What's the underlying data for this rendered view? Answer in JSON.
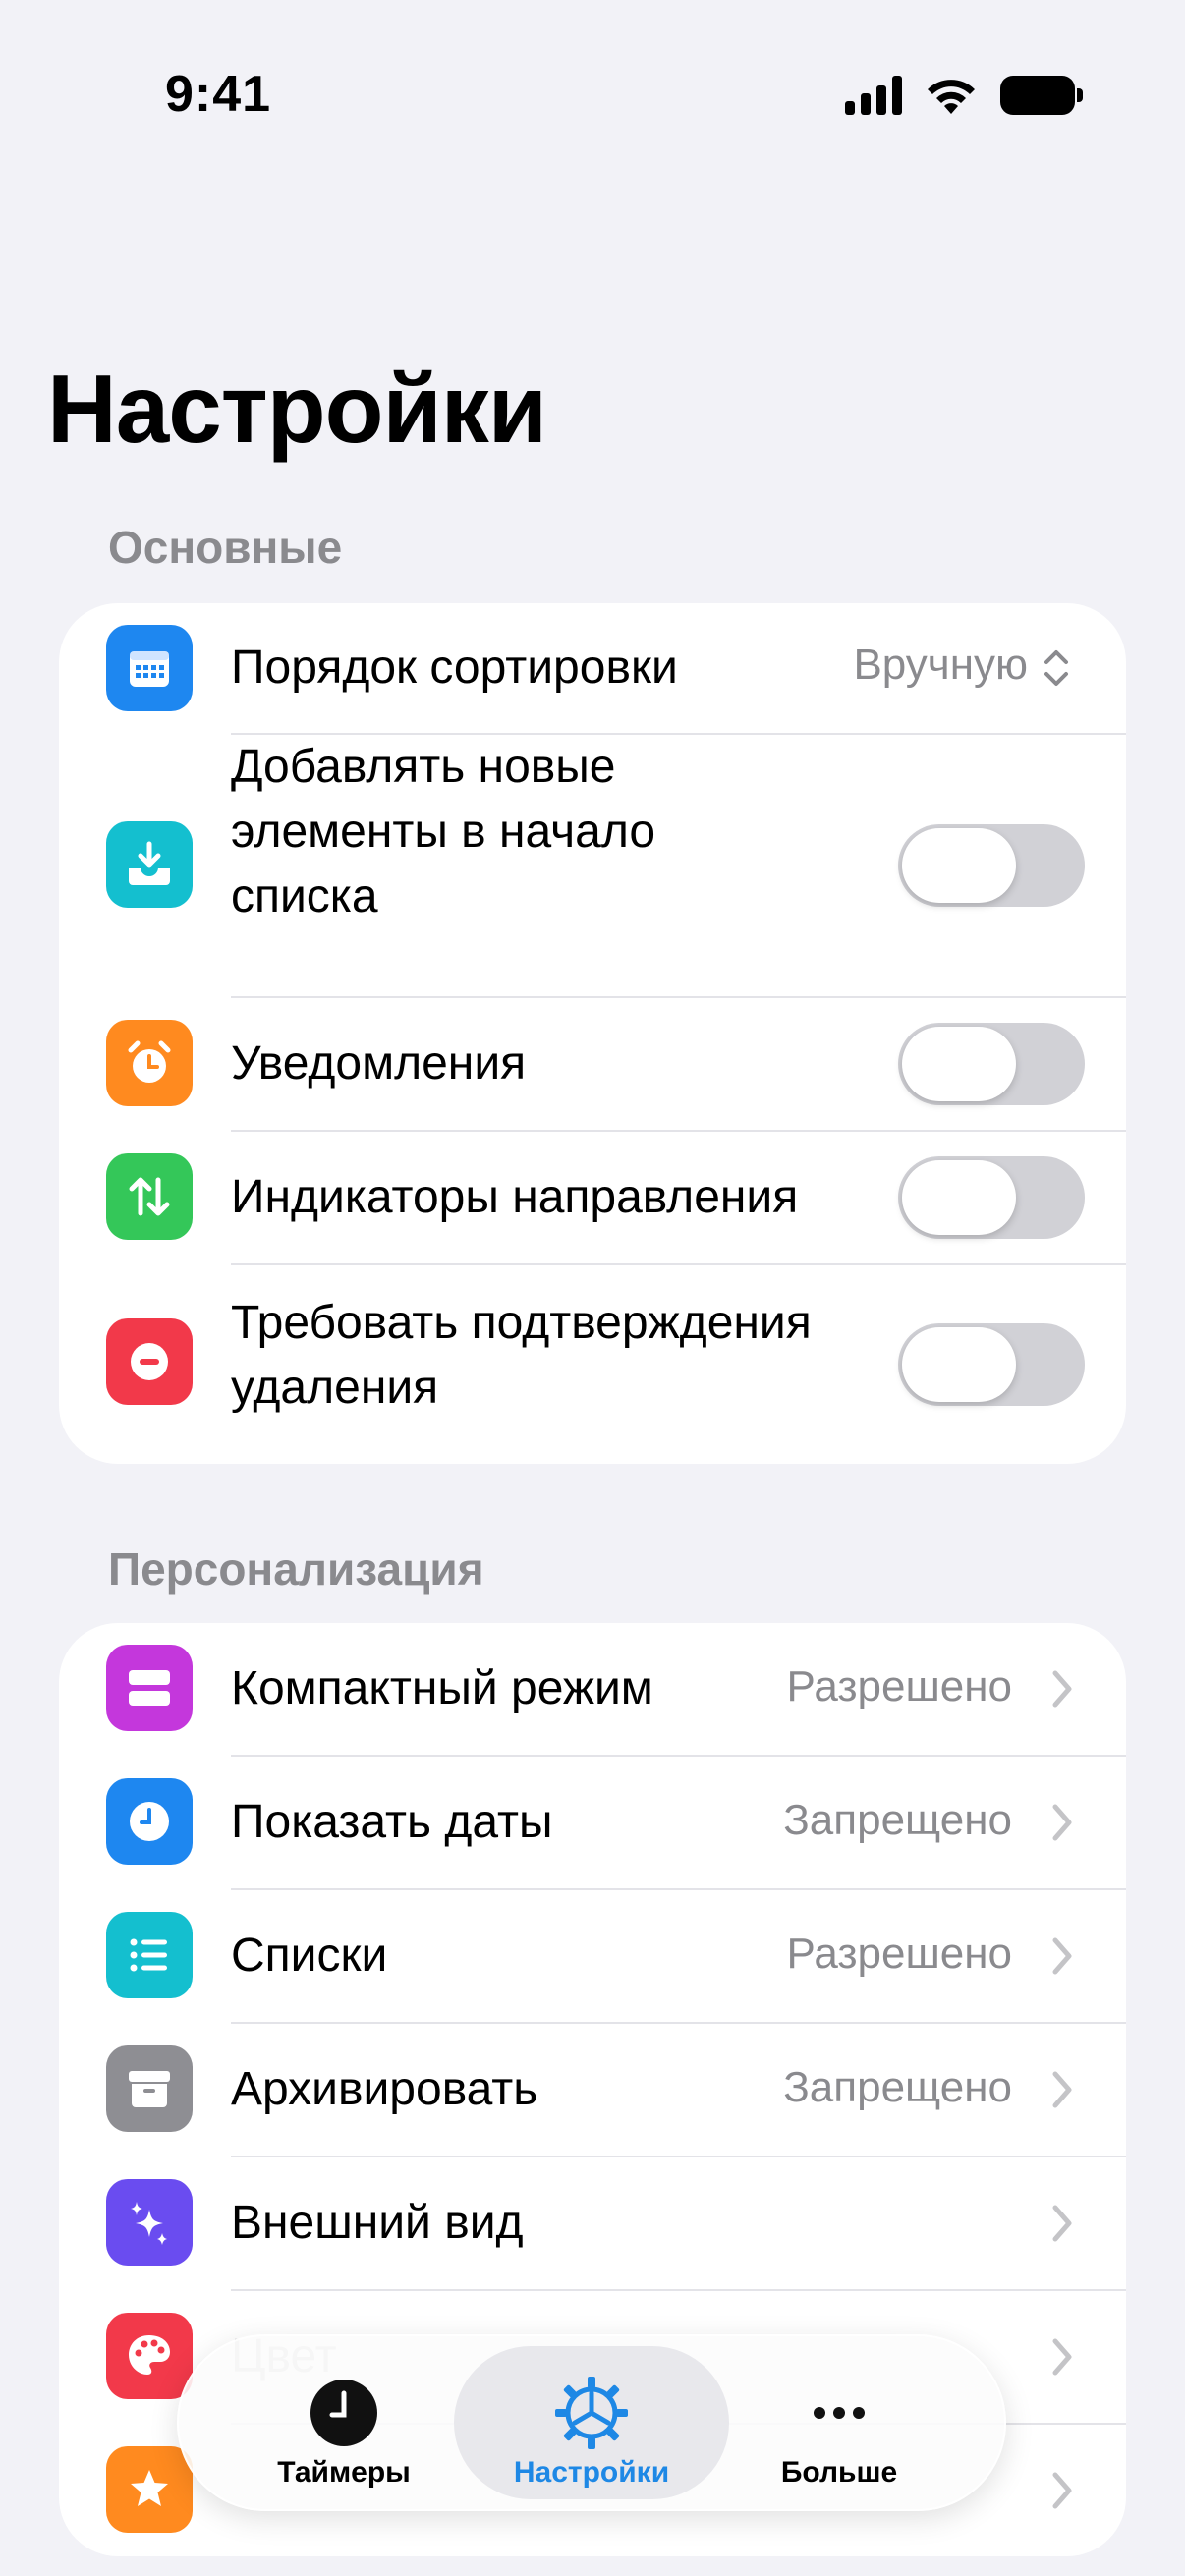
{
  "status_bar": {
    "time": "9:41"
  },
  "page": {
    "title": "Настройки"
  },
  "sections": {
    "general": {
      "header": "Основные",
      "sort_order": {
        "label": "Порядок сортировки",
        "value": "Вручную"
      },
      "add_to_top": {
        "label_line1": "Добавлять новые",
        "label_line2": "элементы в начало",
        "label_line3": "списка",
        "on": false
      },
      "notifications": {
        "label": "Уведомления",
        "on": false
      },
      "direction_indicators": {
        "label": "Индикаторы направления",
        "on": false
      },
      "confirm_delete": {
        "label_line1": "Требовать подтверждения",
        "label_line2": "удаления",
        "on": false
      }
    },
    "personalization": {
      "header": "Персонализация",
      "compact_mode": {
        "label": "Компактный режим",
        "value": "Разрешено"
      },
      "show_dates": {
        "label": "Показать даты",
        "value": "Запрещено"
      },
      "lists": {
        "label": "Списки",
        "value": "Разрешено"
      },
      "archive": {
        "label": "Архивировать",
        "value": "Запрещено"
      },
      "appearance": {
        "label": "Внешний вид"
      },
      "partial_label": "Цвет"
    }
  },
  "tab_bar": {
    "tabs": [
      {
        "label": "Таймеры",
        "icon": "clock-icon"
      },
      {
        "label": "Настройки",
        "icon": "gear-icon",
        "active": true
      },
      {
        "label": "Больше",
        "icon": "ellipsis-icon"
      }
    ]
  },
  "colors": {
    "accent": "#1E88E5",
    "sort_icon": "#1E87F0",
    "inbox_icon": "#14BFCF",
    "alarm_icon": "#FF8A1F",
    "arrows_icon": "#34C759",
    "delete_icon": "#F2394A",
    "compact_icon": "#C437DC",
    "dates_icon": "#1E87F0",
    "lists_icon": "#14BFCF",
    "archive_icon": "#8E8E93",
    "appearance_icon": "#6A4CF0",
    "palette_icon": "#F2394A",
    "star_icon": "#FF8A1F"
  }
}
